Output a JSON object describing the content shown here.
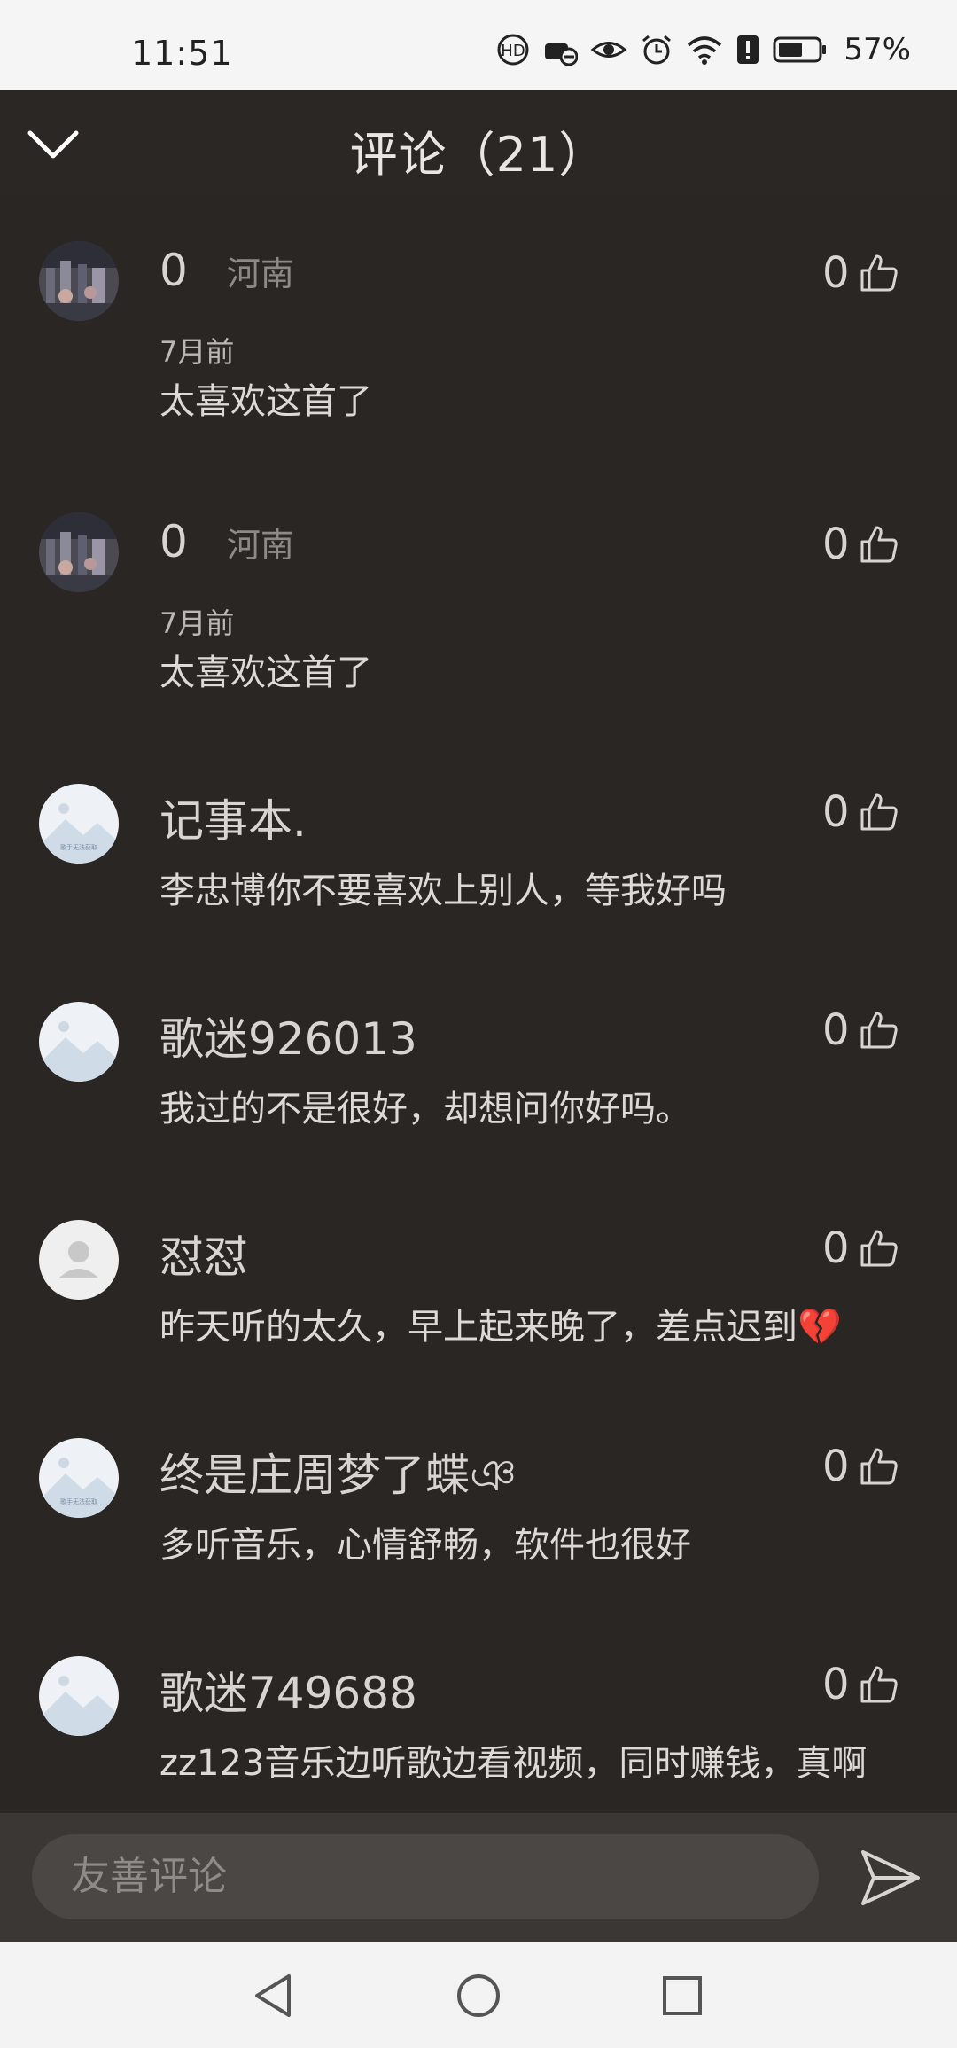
{
  "status_bar": {
    "time": "11:51",
    "battery_percent": "57%",
    "icons": [
      "hd-call-icon",
      "car-mode-icon",
      "eye-icon",
      "alarm-icon",
      "wifi-icon",
      "alert-icon",
      "battery-icon"
    ]
  },
  "header": {
    "title": "评论（21）",
    "back_icon": "chevron-down-icon"
  },
  "comments": [
    {
      "name": "0",
      "location": "河南",
      "date": "7月前",
      "content": "太喜欢这首了",
      "likes": "0",
      "avatar": "photo"
    },
    {
      "name": "0",
      "location": "河南",
      "date": "7月前",
      "content": "太喜欢这首了",
      "likes": "0",
      "avatar": "photo"
    },
    {
      "name": "记事本.",
      "content": "李忠博你不要喜欢上别人，等我好吗",
      "likes": "0",
      "avatar": "mountain-placeholder"
    },
    {
      "name": "歌迷926013",
      "content": "我过的不是很好，却想问你好吗。",
      "likes": "0",
      "avatar": "mountain-placeholder"
    },
    {
      "name": "怼怼",
      "content": "昨天听的太久，早上起来晚了，差点迟到💔",
      "likes": "0",
      "avatar": "person-placeholder"
    },
    {
      "name": "终是庄周梦了蝶ঞ",
      "content": "多听音乐，心情舒畅，软件也很好",
      "likes": "0",
      "avatar": "mountain-placeholder"
    },
    {
      "name": "歌迷749688",
      "content": "zz123音乐边听歌边看视频，同时赚钱，真啊",
      "likes": "0",
      "avatar": "mountain-placeholder"
    }
  ],
  "input": {
    "placeholder": "友善评论",
    "send_icon": "send-icon"
  },
  "nav_bar": {
    "icons": [
      "back-triangle-icon",
      "home-circle-icon",
      "recents-square-icon"
    ]
  },
  "colors": {
    "background": "#2a2623",
    "text": "#d7d5d2",
    "muted": "#8d8a86",
    "status_bar_bg": "#f5f5f5"
  }
}
